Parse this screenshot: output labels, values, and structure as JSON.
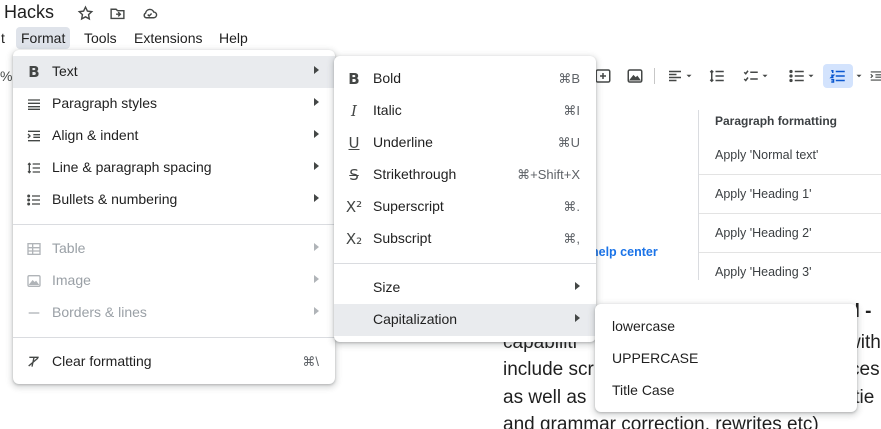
{
  "doc": {
    "title": "Hacks",
    "icons": [
      "star-icon",
      "move-to-folder-icon",
      "cloud-saved-icon"
    ]
  },
  "menubar": {
    "left_fragment": "t",
    "items": [
      "Format",
      "Tools",
      "Extensions",
      "Help"
    ],
    "active": "Format"
  },
  "toolbar": {
    "zoom_fragment": "%",
    "icons": [
      "insert-link-icon",
      "insert-image-icon",
      "align-icon",
      "line-spacing-icon",
      "checklist-icon",
      "bulleted-list-icon",
      "numbered-list-icon",
      "indent-icon"
    ],
    "active": "numbered-list-icon"
  },
  "side_panel": {
    "heading": "Paragraph formatting",
    "items": [
      "Apply 'Normal text'",
      "Apply 'Heading 1'",
      "Apply 'Heading 2'",
      "Apply 'Heading 3'"
    ]
  },
  "help_link": "help center",
  "doc_body": {
    "lines": [
      "capabiliti",
      "include scr",
      "as well as",
      "and grammar correction, rewrites etc)"
    ],
    "right_fragments": [
      "ol -",
      "with",
      "ces",
      "itie"
    ]
  },
  "format_menu": {
    "items": [
      {
        "icon": "bold-icon",
        "label": "Text",
        "submenu": true,
        "highlighted": true
      },
      {
        "icon": "paragraph-styles-icon",
        "label": "Paragraph styles",
        "submenu": true
      },
      {
        "icon": "align-indent-icon",
        "label": "Align & indent",
        "submenu": true
      },
      {
        "icon": "line-spacing-icon",
        "label": "Line & paragraph spacing",
        "submenu": true
      },
      {
        "icon": "bullets-numbering-icon",
        "label": "Bullets & numbering",
        "submenu": true
      },
      {
        "icon": "table-icon",
        "label": "Table",
        "submenu": true,
        "disabled": true
      },
      {
        "icon": "image-icon",
        "label": "Image",
        "submenu": true,
        "disabled": true
      },
      {
        "icon": "borders-lines-icon",
        "label": "Borders & lines",
        "submenu": true,
        "disabled": true
      },
      {
        "icon": "clear-formatting-icon",
        "label": "Clear formatting",
        "shortcut": "⌘\\"
      }
    ]
  },
  "text_submenu": {
    "items": [
      {
        "icon": "bold-icon",
        "label": "Bold",
        "shortcut": "⌘B"
      },
      {
        "icon": "italic-icon",
        "label": "Italic",
        "shortcut": "⌘I"
      },
      {
        "icon": "underline-icon",
        "label": "Underline",
        "shortcut": "⌘U"
      },
      {
        "icon": "strikethrough-icon",
        "label": "Strikethrough",
        "shortcut": "⌘+Shift+X"
      },
      {
        "icon": "superscript-icon",
        "label": "Superscript",
        "shortcut": "⌘."
      },
      {
        "icon": "subscript-icon",
        "label": "Subscript",
        "shortcut": "⌘,"
      },
      {
        "label": "Size",
        "submenu": true
      },
      {
        "label": "Capitalization",
        "submenu": true,
        "highlighted": true
      }
    ]
  },
  "capitalization_submenu": {
    "items": [
      "lowercase",
      "UPPERCASE",
      "Title Case"
    ]
  },
  "colors": {
    "menu_highlight": "#e9ebee",
    "active_menubar": "#dfe3ea",
    "link": "#1a73e8",
    "toolbar_active": "#d3e3fd"
  }
}
